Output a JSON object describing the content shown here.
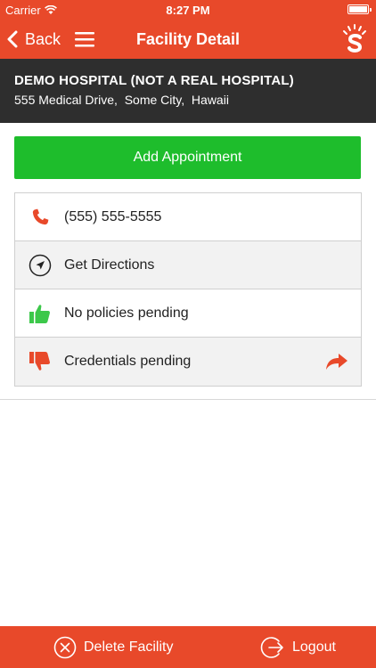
{
  "status_bar": {
    "carrier": "Carrier",
    "time": "8:27 PM"
  },
  "nav": {
    "back_label": "Back",
    "title": "Facility Detail"
  },
  "facility": {
    "name": "DEMO HOSPITAL (NOT A REAL HOSPITAL)",
    "address": "555 Medical Drive,  Some City,  Hawaii"
  },
  "add_appointment_label": "Add Appointment",
  "details": [
    {
      "icon": "phone-icon",
      "text": "(555) 555-5555"
    },
    {
      "icon": "navigation-arrow-icon",
      "text": "Get Directions"
    },
    {
      "icon": "thumbs-up-icon",
      "text": "No policies pending"
    },
    {
      "icon": "thumbs-down-icon",
      "text": "Credentials pending"
    }
  ],
  "bottom_bar": {
    "delete_label": "Delete Facility",
    "logout_label": "Logout"
  },
  "colors": {
    "brand_orange": "#e8492a",
    "header_dark": "#2e2e2e",
    "add_green": "#1ebd2c",
    "thumbs_up_green": "#3cc84a",
    "thumbs_down_red": "#e8492a"
  }
}
